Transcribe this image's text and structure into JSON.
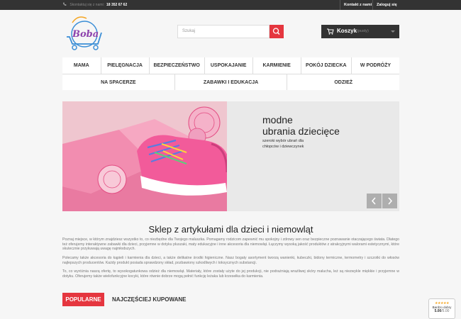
{
  "topbar": {
    "phone_label": "Skontaktuj się z nami:",
    "phone_number": "18 352 67 62",
    "links": [
      "Kontakt z nami",
      "Zaloguj się"
    ]
  },
  "logo": {
    "text": "Boba"
  },
  "search": {
    "placeholder": "Szukaj"
  },
  "cart": {
    "label": "Koszyk",
    "status": "(pusty)"
  },
  "menu": {
    "row1": [
      "MAMA",
      "PIELĘGNACJA",
      "BEZPIECZEŃSTWO",
      "USPOKAJANIE",
      "KARMIENIE",
      "POKÓJ DZIECKA",
      "W PODRÓŻY"
    ],
    "row2": [
      "NA SPACERZE",
      "ZABAWKI I EDUKACJA",
      "ODZIEŻ"
    ]
  },
  "slider": {
    "title_line1": "modne",
    "title_line2": "ubrania dziecięce",
    "subtitle": "szeroki wybór ubrań dla chłopców i dziewczynek"
  },
  "content": {
    "title": "Sklep z artykułami dla dzieci i niemowląt",
    "paragraphs": [
      "Poznaj miejsce, w którym znajdziesz wszystko to, co niezbędne dla Twojego maluszka. Pomagamy rodzicom zapewnić mu spokojny i zdrowy sen oraz bezpieczne poznawanie otaczającego świata. Dlatego też oferujemy interaktywne zabawki dla dzieci, przyjemne w dotyku pluszaki, maty edukacyjne i inne akcesoria dla niemowląt. Łączymy wysoką jakość produktów z atrakcyjnymi walorami estetycznymi, które skutecznie przykuwają uwagę najmłodszych.",
      "Polecamy także akcesoria do kąpieli i karmienia dla dzieci, a także delikatne środki higieniczne. Nasz bogaty asortyment tworzą wanienki, kubeczki, bidony termiczne, termometry i szczotki do włosów najlepszych producentów. Każdy produkt posiada sprawdzony skład, pozbawiony szkodliwych i toksycznych substancji.",
      "To, co wyróżnia naszą ofertę, to wysokogatunkowa odzież dla niemowląt. Materiały, które zostały użyte do jej produkcji, nie podrażniają wrażliwej skóry malucha, leż są niezwykle miękkie i przyjemne w dotyku. Oferujemy także wielofunkcyjne kocyki, które równie dobrze mogą pełnić funkcję leżaka lub krzesełka do karmienia."
    ]
  },
  "tabs": {
    "popular": "POPULARNE",
    "bestsellers": "NAJCZĘŚCIEJ KUPOWANE"
  },
  "badge": {
    "stars": "★★★★★",
    "text": "Bardzo dobry",
    "score": "5.00",
    "max": "/5.00"
  },
  "colors": {
    "accent": "#e5363f",
    "dark": "#333333"
  }
}
